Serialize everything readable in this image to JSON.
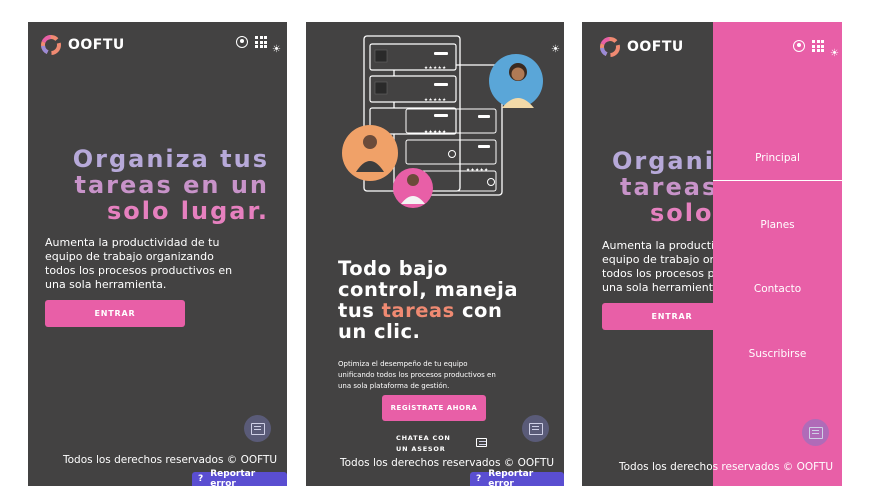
{
  "brand": {
    "name": "OOFTU",
    "accent": "#e85fa7",
    "bg": "#434242"
  },
  "screen1": {
    "hero_lines": [
      "Organiza tus",
      "tareas en un",
      "solo lugar."
    ],
    "paragraph": [
      "Aumenta la productividad de tu",
      "equipo de trabajo organizando",
      "todos los procesos productivos en",
      "una sola herramienta."
    ],
    "cta_label": "ENTRAR",
    "footer": "Todos los derechos reservados © OOFTU",
    "report_label": "Reportar error",
    "report_mark": "?"
  },
  "screen2": {
    "title_line1": "Todo bajo",
    "title_line2": "control, maneja",
    "title_line3_a": "tus ",
    "title_line3_b": "tareas",
    "title_line3_c": " con",
    "title_line4": "un clic.",
    "paragraph": [
      "Optimiza el desempeño de tu equipo",
      "unificando todos los procesos productivos en",
      "una sola plataforma de gestión."
    ],
    "cta_label": "REGÍSTRATE AHORA",
    "asesor_line1": "CHATEA CON",
    "asesor_line2": "UN ASESOR",
    "stars": "★★★★★",
    "footer": "Todos los derechos reservados © OOFTU",
    "report_label": "Reportar error",
    "report_mark": "?"
  },
  "screen3": {
    "hero_lines": [
      "Organiza tus",
      "tareas en un",
      "solo lugar."
    ],
    "paragraph": [
      "Aumenta la productividad de tu",
      "equipo de trabajo organizando",
      "todos los procesos productivos en",
      "una sola herramienta."
    ],
    "cta_label": "ENTRAR",
    "menu": [
      "Principal",
      "Planes",
      "Contacto",
      "Suscribirse"
    ],
    "footer": "Todos los derechos reservados © OOFTU"
  },
  "icons": [
    "logo-icon",
    "user-icon",
    "apps-grid-icon",
    "brightness-icon",
    "chat-icon",
    "help-icon"
  ]
}
